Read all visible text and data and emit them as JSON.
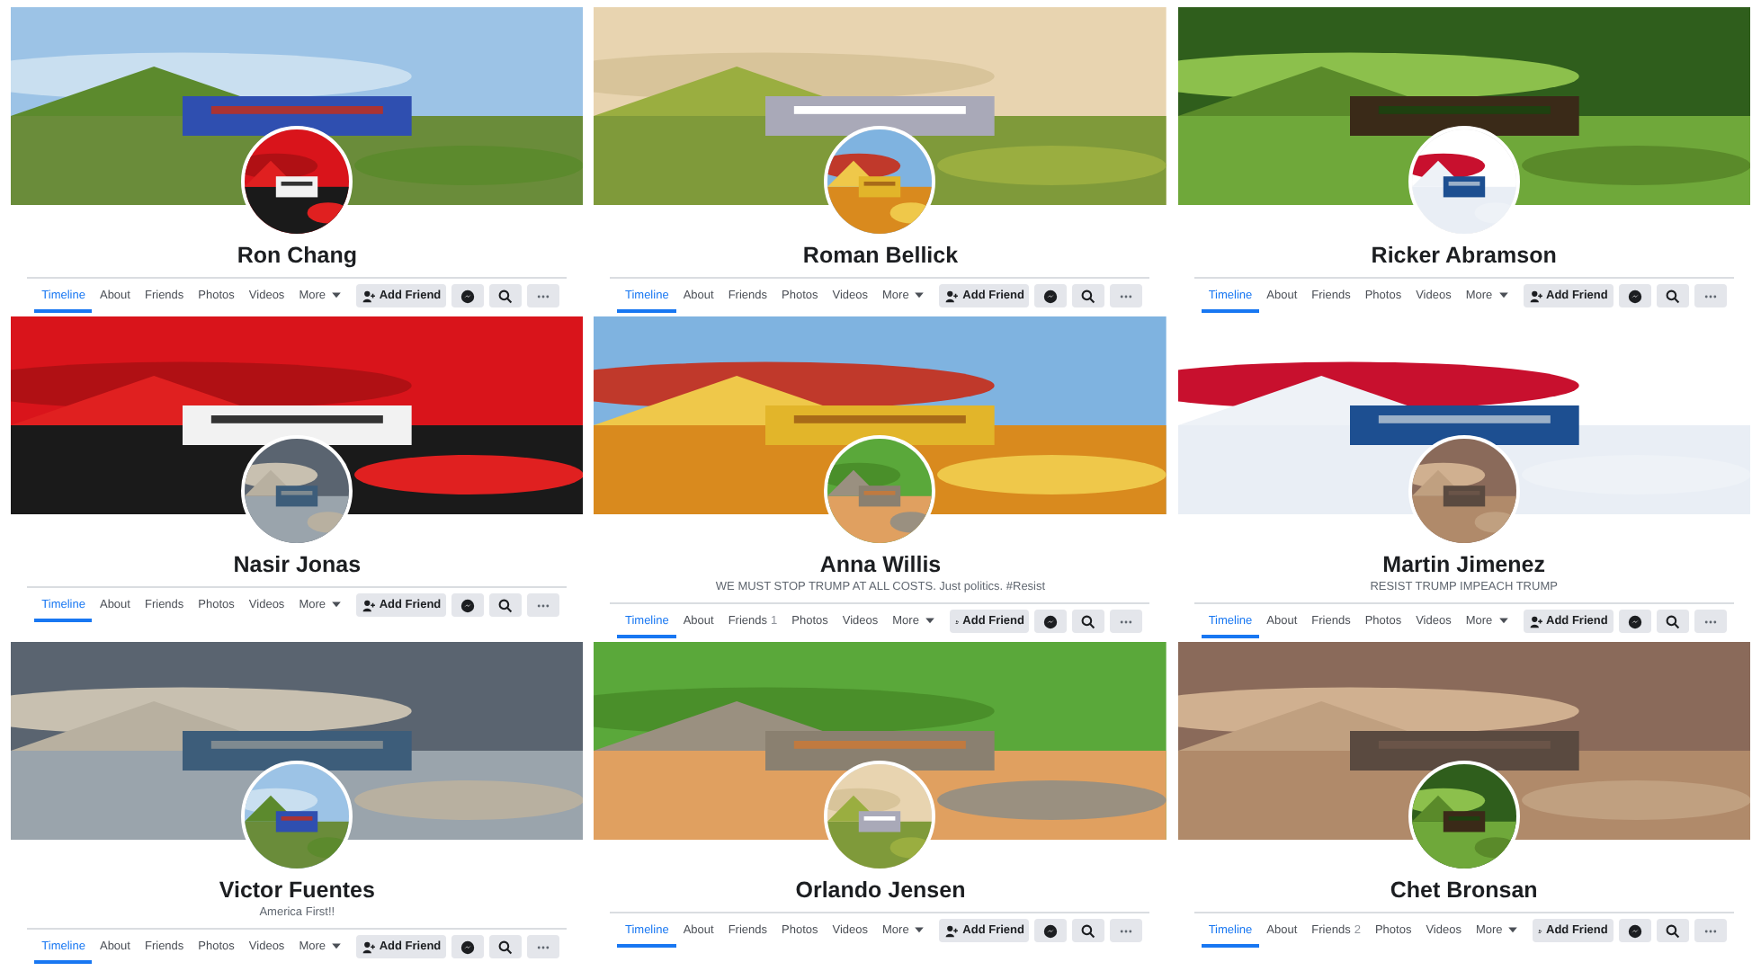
{
  "profiles": [
    {
      "name": "Ron Chang",
      "tabs": [
        {
          "label": "Timeline",
          "selected": true
        },
        {
          "label": "About",
          "selected": false
        },
        {
          "label": "Friends",
          "selected": false
        },
        {
          "label": "Photos",
          "selected": false
        },
        {
          "label": "Videos",
          "selected": false
        },
        {
          "label": "More",
          "selected": false
        }
      ],
      "add_friend": "Add Friend"
    },
    {
      "name": "Roman Bellick",
      "tabs": [
        {
          "label": "Timeline",
          "selected": true
        },
        {
          "label": "About",
          "selected": false
        },
        {
          "label": "Friends",
          "selected": false
        },
        {
          "label": "Photos",
          "selected": false
        },
        {
          "label": "Videos",
          "selected": false
        },
        {
          "label": "More",
          "selected": false
        }
      ],
      "add_friend": "Add Friend"
    },
    {
      "name": "Ricker Abramson",
      "tabs": [
        {
          "label": "Timeline",
          "selected": true
        },
        {
          "label": "About",
          "selected": false
        },
        {
          "label": "Friends",
          "selected": false
        },
        {
          "label": "Photos",
          "selected": false
        },
        {
          "label": "Videos",
          "selected": false
        },
        {
          "label": "More",
          "selected": false
        }
      ],
      "add_friend": "Add Friend"
    },
    {
      "name": "Nasir Jonas",
      "tabs": [
        {
          "label": "Timeline",
          "selected": true
        },
        {
          "label": "About",
          "selected": false
        },
        {
          "label": "Friends",
          "selected": false
        },
        {
          "label": "Photos",
          "selected": false
        },
        {
          "label": "Videos",
          "selected": false
        },
        {
          "label": "More",
          "selected": false
        }
      ],
      "add_friend": "Add Friend"
    },
    {
      "name": "Anna Willis",
      "bio": "WE MUST STOP TRUMP AT ALL COSTS. Just politics. #Resist",
      "tabs": [
        {
          "label": "Timeline",
          "selected": true
        },
        {
          "label": "About",
          "selected": false
        },
        {
          "label": "Friends",
          "count": "1",
          "selected": false
        },
        {
          "label": "Photos",
          "selected": false
        },
        {
          "label": "Videos",
          "selected": false
        },
        {
          "label": "More",
          "selected": false
        }
      ],
      "add_friend": "Add Friend"
    },
    {
      "name": "Martin Jimenez",
      "bio": "RESIST TRUMP IMPEACH TRUMP",
      "tabs": [
        {
          "label": "Timeline",
          "selected": true
        },
        {
          "label": "About",
          "selected": false
        },
        {
          "label": "Friends",
          "selected": false
        },
        {
          "label": "Photos",
          "selected": false
        },
        {
          "label": "Videos",
          "selected": false
        },
        {
          "label": "More",
          "selected": false
        }
      ],
      "add_friend": "Add Friend"
    },
    {
      "name": "Victor Fuentes",
      "bio": "America First!!",
      "tabs": [
        {
          "label": "Timeline",
          "selected": true
        },
        {
          "label": "About",
          "selected": false
        },
        {
          "label": "Friends",
          "selected": false
        },
        {
          "label": "Photos",
          "selected": false
        },
        {
          "label": "Videos",
          "selected": false
        },
        {
          "label": "More",
          "selected": false
        }
      ],
      "add_friend": "Add Friend"
    },
    {
      "name": "Orlando Jensen",
      "tabs": [
        {
          "label": "Timeline",
          "selected": true
        },
        {
          "label": "About",
          "selected": false
        },
        {
          "label": "Friends",
          "selected": false
        },
        {
          "label": "Photos",
          "selected": false
        },
        {
          "label": "Videos",
          "selected": false
        },
        {
          "label": "More",
          "selected": false
        }
      ],
      "add_friend": "Add Friend"
    },
    {
      "name": "Chet Bronsan",
      "tabs": [
        {
          "label": "Timeline",
          "selected": true
        },
        {
          "label": "About",
          "selected": false
        },
        {
          "label": "Friends",
          "count": "2",
          "selected": false
        },
        {
          "label": "Photos",
          "selected": false
        },
        {
          "label": "Videos",
          "selected": false
        },
        {
          "label": "More",
          "selected": false
        }
      ],
      "add_friend": "Add Friend"
    }
  ]
}
